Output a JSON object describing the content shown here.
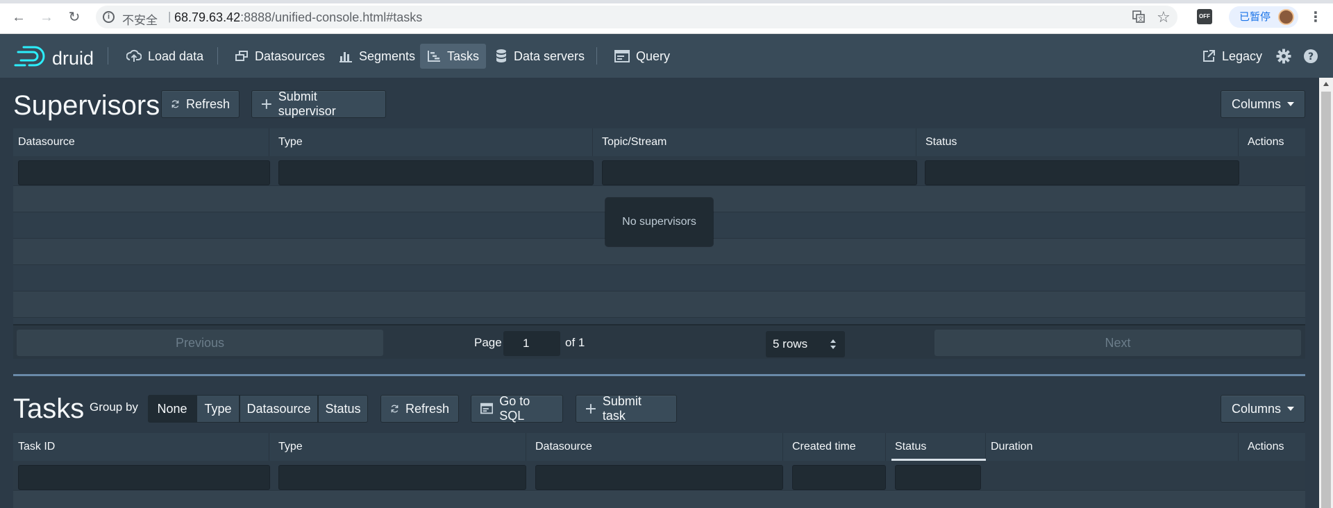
{
  "browser": {
    "insecure_label": "不安全",
    "separator": "|",
    "url_host": "68.79.63.42",
    "url_rest": ":8888/unified-console.html#tasks",
    "ext_label": "OFF",
    "paused_label": "已暂停"
  },
  "header": {
    "logo_text": "druid",
    "nav": {
      "load_data": "Load data",
      "datasources": "Datasources",
      "segments": "Segments",
      "tasks": "Tasks",
      "data_servers": "Data servers",
      "query": "Query",
      "legacy": "Legacy"
    },
    "active_nav": "Tasks"
  },
  "supervisors": {
    "title": "Supervisors",
    "refresh_label": "Refresh",
    "submit_label": "Submit supervisor",
    "columns_label": "Columns",
    "columns": [
      "Datasource",
      "Type",
      "Topic/Stream",
      "Status",
      "Actions"
    ],
    "empty_message": "No supervisors",
    "pagination": {
      "previous": "Previous",
      "page_label": "Page",
      "page_value": "1",
      "of_label": "of 1",
      "rows_label": "5 rows",
      "next": "Next"
    }
  },
  "tasks": {
    "title": "Tasks",
    "group_by_label": "Group by",
    "group_by_options": [
      "None",
      "Type",
      "Datasource",
      "Status"
    ],
    "group_by_selected": "None",
    "refresh_label": "Refresh",
    "go_to_sql_label": "Go to SQL",
    "submit_label": "Submit task",
    "columns_label": "Columns",
    "columns": [
      "Task ID",
      "Type",
      "Datasource",
      "Created time",
      "Status",
      "Duration",
      "Actions"
    ],
    "sorted_column": "Status"
  },
  "colors": {
    "background": "#2c3a47",
    "header": "#394b59",
    "input": "#202b33",
    "divider": "#7fa6c9",
    "browser_accent": "#1a73e8"
  }
}
